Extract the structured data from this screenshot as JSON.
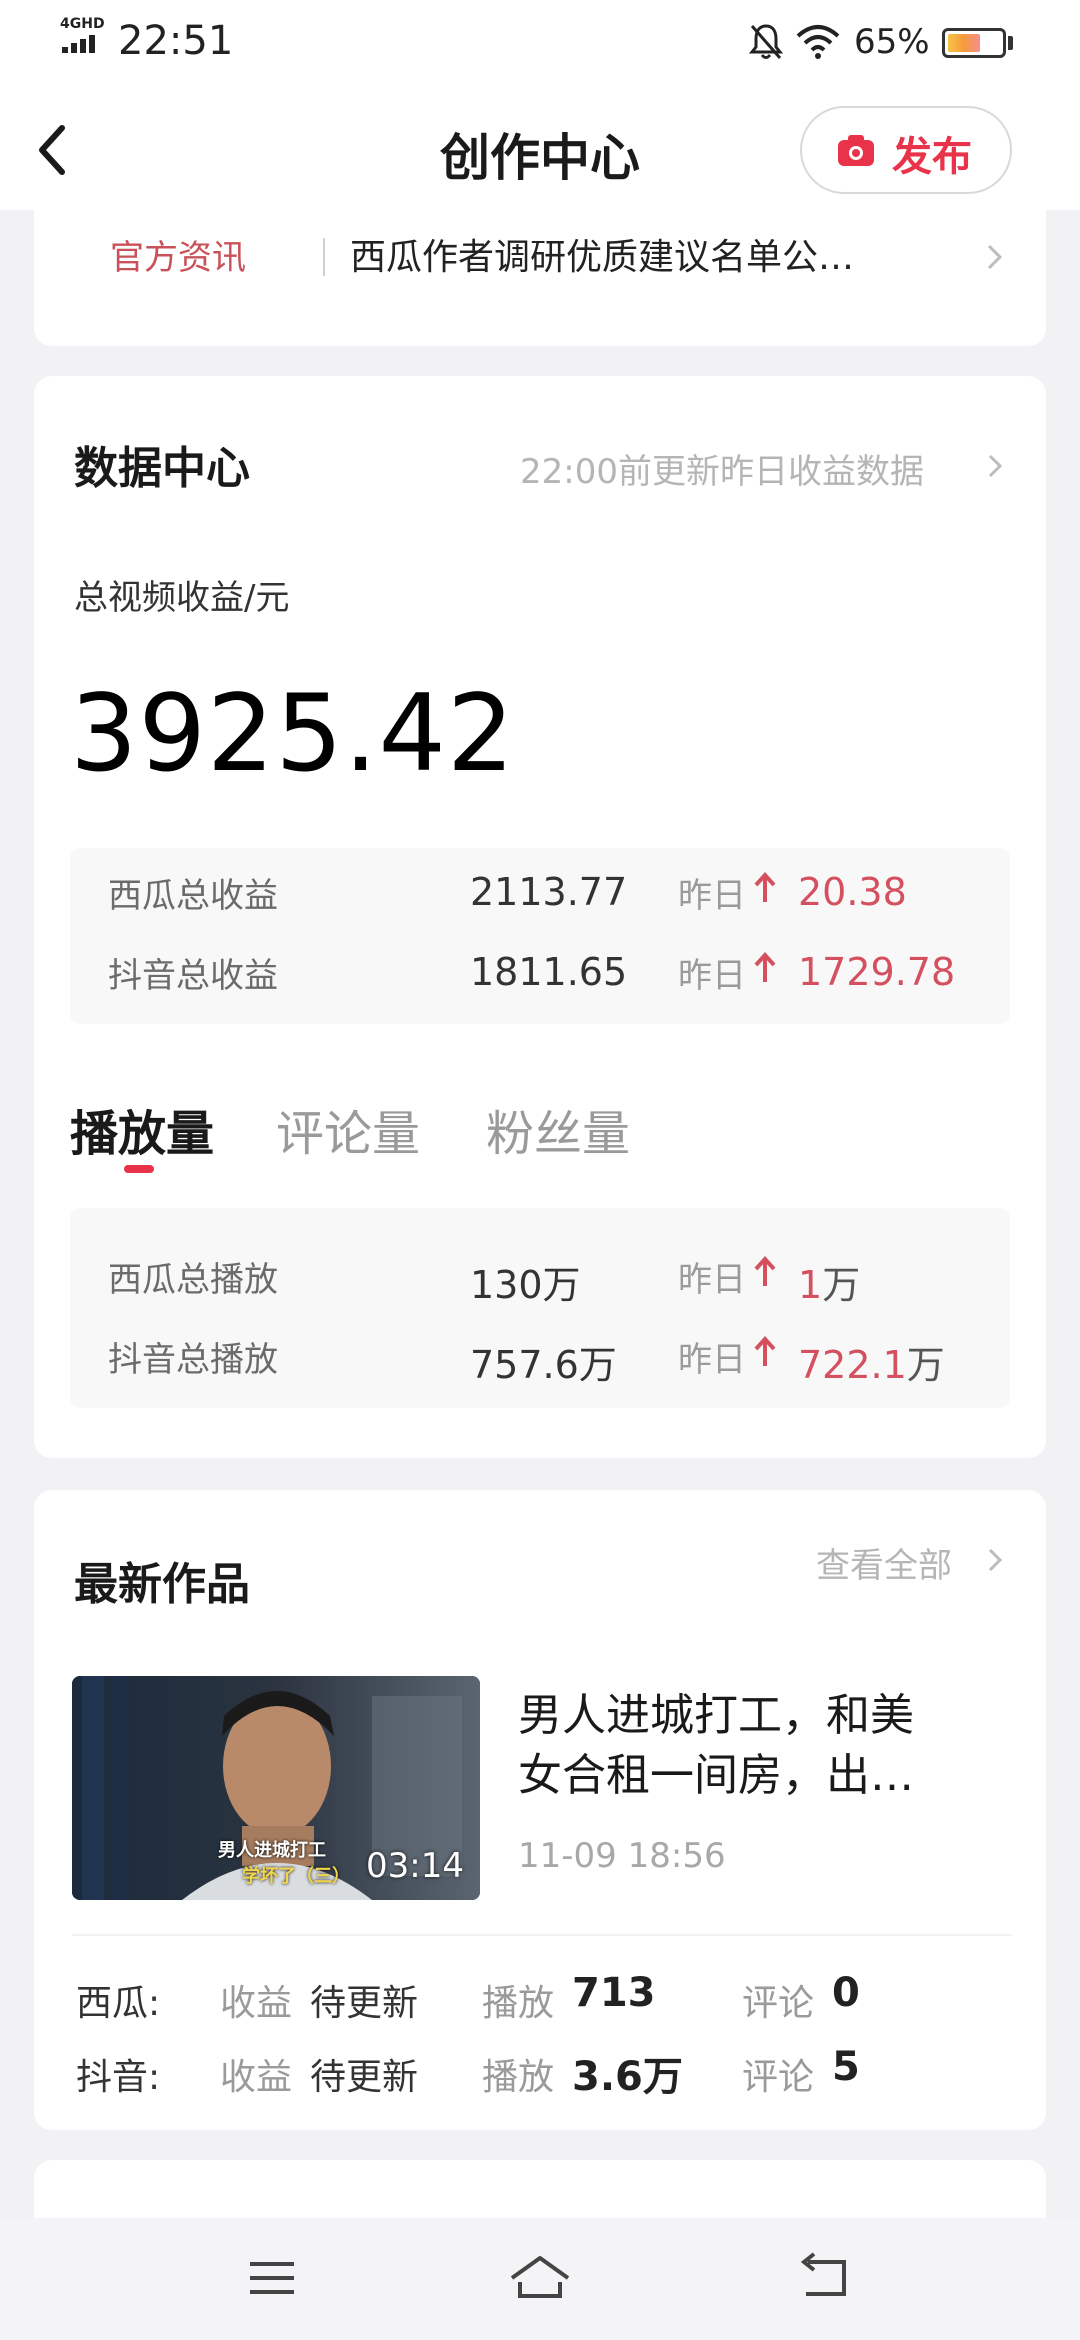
{
  "status_bar": {
    "network": "4GHD",
    "time": "22:51",
    "battery": "65%",
    "battery_level": 0.65,
    "icons": [
      "signal-icon",
      "mute-bell-icon",
      "wifi-icon",
      "battery-icon"
    ]
  },
  "nav": {
    "title": "创作中心",
    "publish_label": "发布",
    "icons": [
      "back-icon",
      "camera-icon"
    ]
  },
  "news": {
    "tag": "官方资讯",
    "text": "西瓜作者调研优质建议名单公…"
  },
  "data_center": {
    "title": "数据中心",
    "update_note": "22:00前更新昨日收益数据",
    "income_label": "总视频收益/元",
    "income_total": "3925.42",
    "income_rows": [
      {
        "name": "西瓜总收益",
        "value": "2113.77",
        "yesterday_label": "昨日",
        "delta": "20.38",
        "unit": ""
      },
      {
        "name": "抖音总收益",
        "value": "1811.65",
        "yesterday_label": "昨日",
        "delta": "1729.78",
        "unit": ""
      }
    ],
    "tabs": [
      "播放量",
      "评论量",
      "粉丝量"
    ],
    "active_tab": 0,
    "play_rows": [
      {
        "name": "西瓜总播放",
        "value": "130万",
        "yesterday_label": "昨日",
        "delta": "1",
        "unit": "万"
      },
      {
        "name": "抖音总播放",
        "value": "757.6万",
        "yesterday_label": "昨日",
        "delta": "722.1",
        "unit": "万"
      }
    ],
    "accent_color": "#e8334a",
    "delta_color": "#d4505e"
  },
  "latest_works": {
    "title": "最新作品",
    "view_all": "查看全部",
    "item": {
      "title_line1": "男人进城打工，和美",
      "title_line2": "女合租一间房，出…",
      "date": "11-09 18:56",
      "duration": "03:14",
      "thumb_caption": "男人进城打工",
      "thumb_caption2": "学坏了（三）"
    },
    "metrics": [
      {
        "platform": "西瓜:",
        "income_label": "收益",
        "income_value": "待更新",
        "play_label": "播放",
        "play_value": "713",
        "comment_label": "评论",
        "comment_value": "0"
      },
      {
        "platform": "抖音:",
        "income_label": "收益",
        "income_value": "待更新",
        "play_label": "播放",
        "play_value": "3.6万",
        "comment_label": "评论",
        "comment_value": "5"
      }
    ]
  },
  "system_nav": {
    "icons": [
      "menu-icon",
      "home-icon",
      "back-nav-icon"
    ]
  }
}
